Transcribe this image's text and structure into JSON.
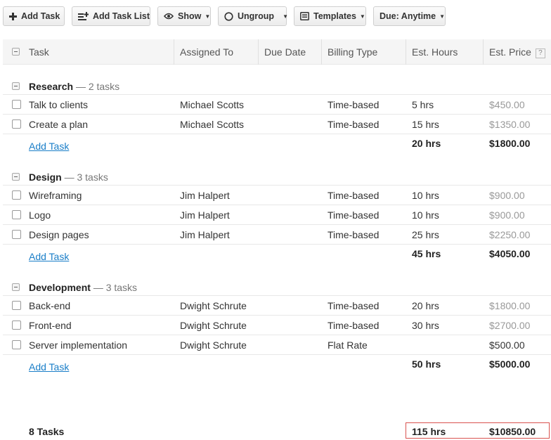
{
  "toolbar": {
    "add_task": "Add Task",
    "add_task_list": "Add Task List",
    "show": "Show",
    "ungroup": "Ungroup",
    "templates": "Templates",
    "due": "Due: Anytime"
  },
  "columns": {
    "task": "Task",
    "assigned_to": "Assigned To",
    "due_date": "Due Date",
    "billing_type": "Billing Type",
    "est_hours": "Est. Hours",
    "est_price": "Est. Price",
    "help": "?"
  },
  "groups": [
    {
      "name": "Research",
      "count": "— 2 tasks",
      "tasks": [
        {
          "name": "Talk to clients",
          "assigned": "Michael Scotts",
          "due": "",
          "billing": "Time-based",
          "hours": "5 hrs",
          "price": "$450.00"
        },
        {
          "name": "Create a plan",
          "assigned": "Michael Scotts",
          "due": "",
          "billing": "Time-based",
          "hours": "15 hrs",
          "price": "$1350.00"
        }
      ],
      "add_task": "Add Task",
      "total_hours": "20 hrs",
      "total_price": "$1800.00"
    },
    {
      "name": "Design",
      "count": "— 3 tasks",
      "tasks": [
        {
          "name": "Wireframing",
          "assigned": "Jim Halpert",
          "due": "",
          "billing": "Time-based",
          "hours": "10 hrs",
          "price": "$900.00"
        },
        {
          "name": "Logo",
          "assigned": "Jim Halpert",
          "due": "",
          "billing": "Time-based",
          "hours": "10 hrs",
          "price": "$900.00"
        },
        {
          "name": "Design pages",
          "assigned": "Jim Halpert",
          "due": "",
          "billing": "Time-based",
          "hours": "25 hrs",
          "price": "$2250.00"
        }
      ],
      "add_task": "Add Task",
      "total_hours": "45 hrs",
      "total_price": "$4050.00"
    },
    {
      "name": "Development",
      "count": "— 3 tasks",
      "tasks": [
        {
          "name": "Back-end",
          "assigned": "Dwight Schrute",
          "due": "",
          "billing": "Time-based",
          "hours": "20 hrs",
          "price": "$1800.00"
        },
        {
          "name": "Front-end",
          "assigned": "Dwight Schrute",
          "due": "",
          "billing": "Time-based",
          "hours": "30 hrs",
          "price": "$2700.00"
        },
        {
          "name": "Server implementation",
          "assigned": "Dwight Schrute",
          "due": "",
          "billing": "Flat Rate",
          "hours": "",
          "price": "$500.00"
        }
      ],
      "add_task": "Add Task",
      "total_hours": "50 hrs",
      "total_price": "$5000.00"
    }
  ],
  "footer": {
    "task_count": "8 Tasks",
    "total_hours": "115 hrs",
    "total_price": "$10850.00"
  },
  "colors": {
    "link": "#1a7ec8",
    "muted_price": "#999999",
    "totals_border": "#d9534f",
    "header_bg": "#f5f5f5"
  },
  "icons": [
    "plus-icon",
    "add-list-icon",
    "eye-icon",
    "circle-icon",
    "template-icon",
    "caret-down-icon",
    "collapse-icon",
    "checkbox-icon"
  ]
}
